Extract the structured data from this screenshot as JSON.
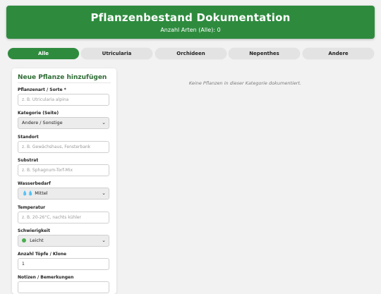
{
  "header": {
    "title": "Pflanzenbestand Dokumentation",
    "subtitle": "Anzahl Arten (Alle): 0"
  },
  "tabs": [
    {
      "label": "Alle",
      "active": true
    },
    {
      "label": "Utricularia",
      "active": false
    },
    {
      "label": "Orchideen",
      "active": false
    },
    {
      "label": "Nepenthes",
      "active": false
    },
    {
      "label": "Andere",
      "active": false
    }
  ],
  "form": {
    "title": "Neue Pflanze hinzufügen",
    "species_label": "Pflanzenart / Sorte *",
    "species_placeholder": "z. B. Utricularia alpina",
    "category_label": "Kategorie (Seite)",
    "category_value": "Andere / Sonstige",
    "location_label": "Standort",
    "location_placeholder": "z. B. Gewächshaus, Fensterbank",
    "substrate_label": "Substrat",
    "substrate_placeholder": "z. B. Sphagnum-Torf-Mix",
    "water_label": "Wasserbedarf",
    "water_icons": "💧💧",
    "water_value": "Mittel",
    "temp_label": "Temperatur",
    "temp_placeholder": "z. B. 20-26°C, nachts kühler",
    "difficulty_label": "Schwierigkeit",
    "difficulty_value": "Leicht",
    "pots_label": "Anzahl Töpfe / Klone",
    "pots_value": "1",
    "notes_label": "Notizen / Bemerkungen"
  },
  "empty_message": "Keine Pflanzen in dieser Kategorie dokumentiert.",
  "colors": {
    "brand_green": "#2e8b3e",
    "difficulty_dot": "#4caf50"
  }
}
